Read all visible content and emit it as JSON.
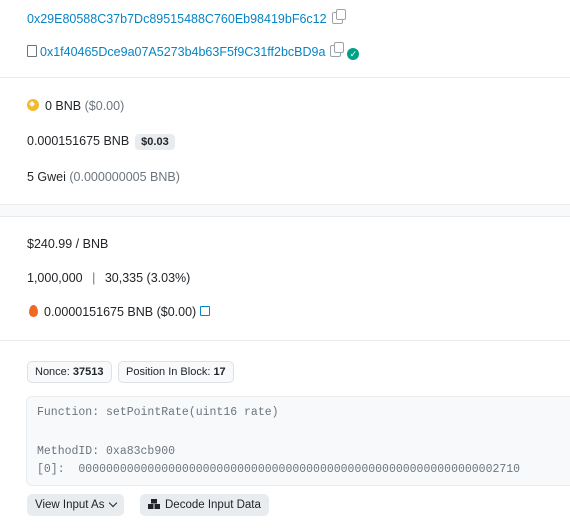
{
  "addresses": {
    "to": "0x29E80588C37b7Dc89515488C760Eb98419bF6c12",
    "contract": "0x1f40465Dce9a07A5273b4b63F5f9C31ff2bcBD9a"
  },
  "value": {
    "amount": "0 BNB",
    "usd": "($0.00)"
  },
  "fee": {
    "amount": "0.000151675 BNB",
    "usd_badge": "$0.03"
  },
  "gas_price": {
    "amount": "5 Gwei",
    "detail": "(0.000000005 BNB)"
  },
  "bnb_price": "$240.99 / BNB",
  "gas_limit_usage": {
    "limit": "1,000,000",
    "separator": "|",
    "usage": "30,335 (3.03%)"
  },
  "burnt_fees": "0.0000151675 BNB ($0.00)",
  "nonce": {
    "label": "Nonce:",
    "value": "37513"
  },
  "position": {
    "label": "Position In Block:",
    "value": "17"
  },
  "input_data": {
    "function_line": "Function: setPointRate(uint16 rate)",
    "method_line": "MethodID: 0xa83cb900",
    "param_line": "[0]:  0000000000000000000000000000000000000000000000000000000000002710"
  },
  "buttons": {
    "view_input": "View Input As",
    "decode": "Decode Input Data"
  },
  "colors": {
    "link": "#0784c3",
    "verified": "#00a186",
    "bnb": "#f3ba2f",
    "fire": "#f26722"
  }
}
